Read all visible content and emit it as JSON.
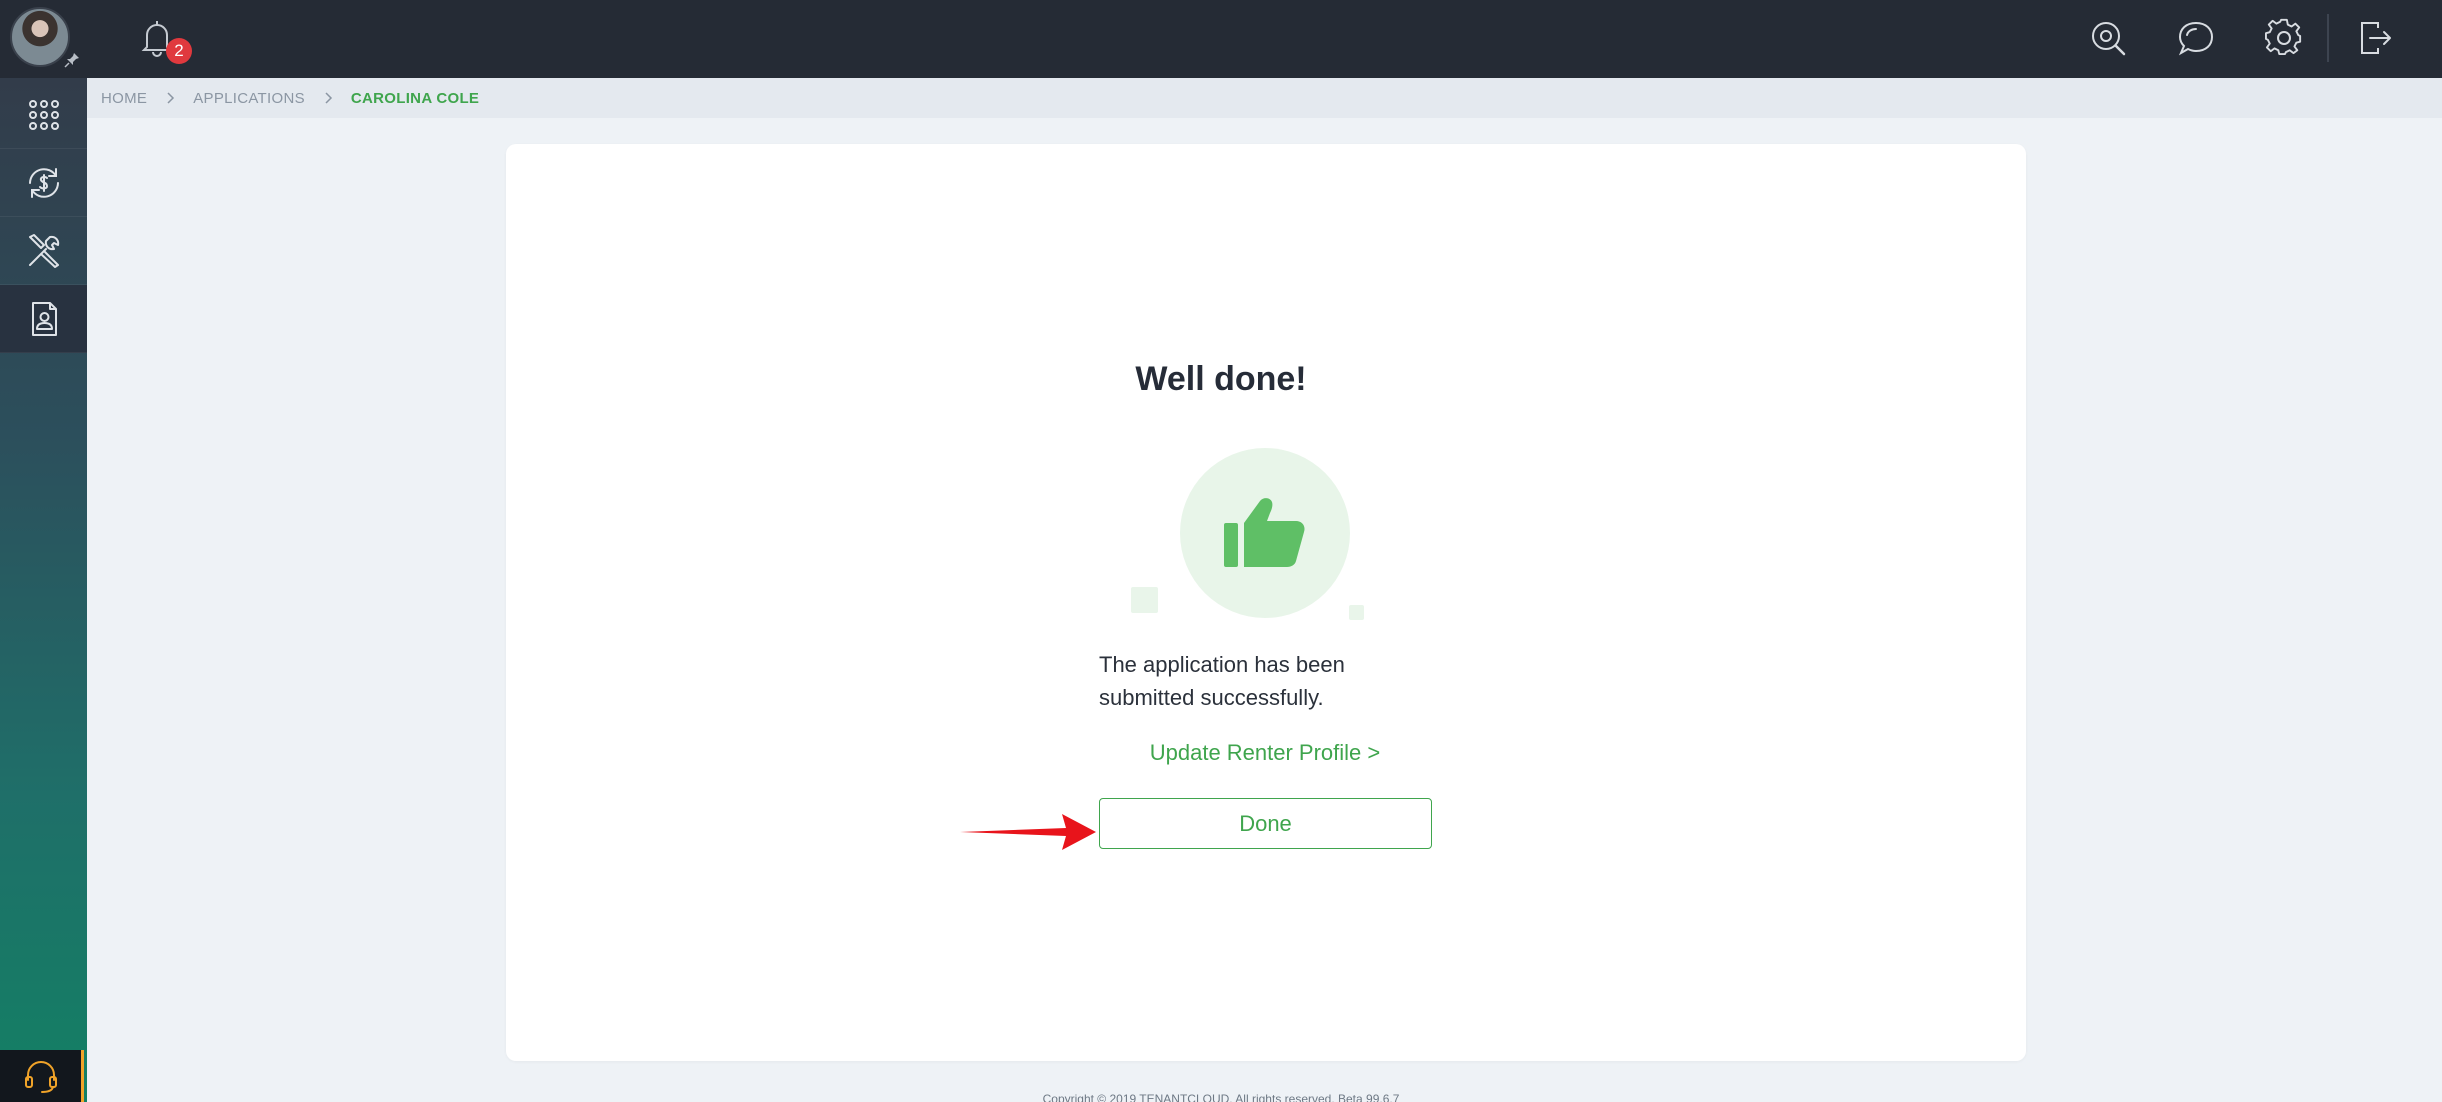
{
  "header": {
    "notification_count": "2",
    "icons": [
      "search-icon",
      "chat-icon",
      "gear-icon",
      "logout-icon"
    ]
  },
  "sidebar": {
    "items": [
      {
        "name": "apps-grid-icon"
      },
      {
        "name": "money-cycle-icon"
      },
      {
        "name": "tools-icon"
      },
      {
        "name": "profile-document-icon",
        "active": true
      }
    ],
    "support_icon": "headset-icon",
    "support_accent": "#f0a329"
  },
  "breadcrumb": {
    "items": [
      "HOME",
      "APPLICATIONS",
      "CAROLINA COLE"
    ]
  },
  "main": {
    "title": "Well done!",
    "message": "The application has been submitted successfully.",
    "update_link": "Update Renter Profile >",
    "done_label": "Done"
  },
  "footer": {
    "text": "Copyright © 2019 TENANTCLOUD. All rights reserved. Beta 99.6.7"
  },
  "colors": {
    "accent": "#3fa54d",
    "topbar": "#252b35",
    "badge": "#e0393e",
    "arrow": "#e8141b"
  }
}
